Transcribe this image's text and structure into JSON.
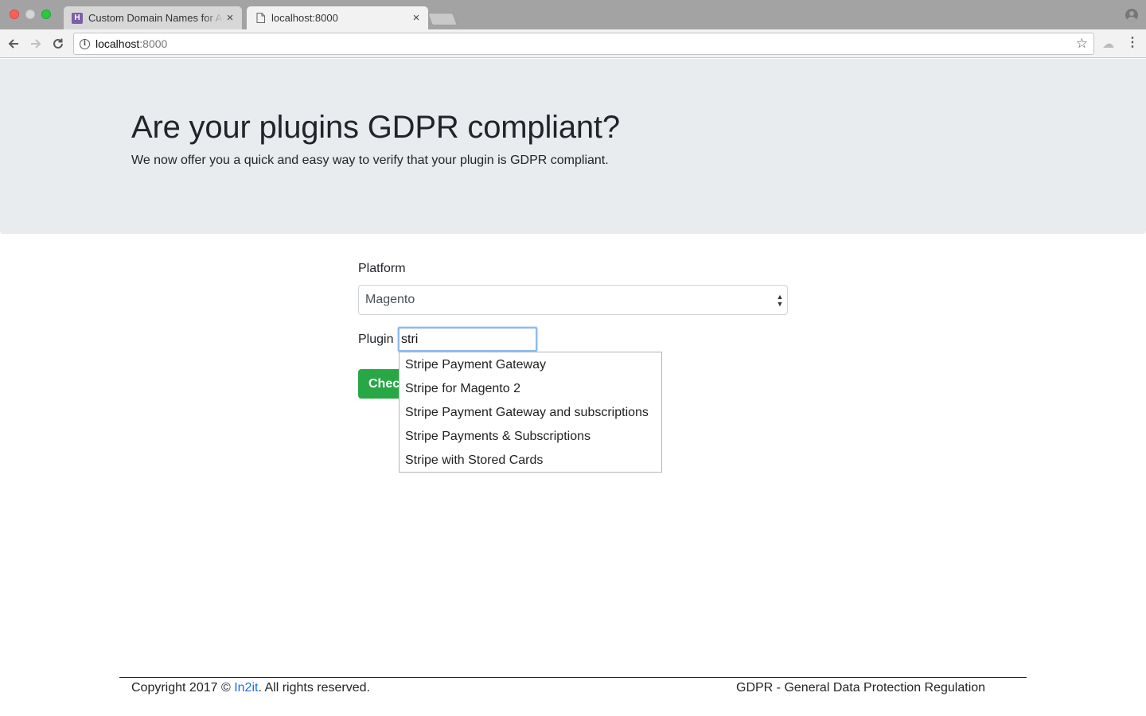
{
  "browser": {
    "tabs": [
      {
        "title": "Custom Domain Names for Ap",
        "favicon": "H",
        "active": false
      },
      {
        "title": "localhost:8000",
        "active": true
      }
    ],
    "url_host": "localhost",
    "url_port": ":8000"
  },
  "hero": {
    "title": "Are your plugins GDPR compliant?",
    "subtitle": "We now offer you a quick and easy way to verify that your plugin is GDPR compliant."
  },
  "form": {
    "platform_label": "Platform",
    "platform_value": "Magento",
    "plugin_label": "Plugin",
    "plugin_value": "stri",
    "submit_label": "Check"
  },
  "autocomplete": {
    "items": [
      "Stripe Payment Gateway",
      "Stripe for Magento 2",
      "Stripe Payment Gateway and subscriptions",
      "Stripe Payments & Subscriptions",
      "Stripe with Stored Cards"
    ]
  },
  "footer": {
    "copyright_prefix": "Copyright 2017 © ",
    "company_link": "In2it",
    "copyright_suffix": ". All rights reserved.",
    "right_text": "GDPR - General Data Protection Regulation"
  },
  "colors": {
    "jumbotron_bg": "#e9ecef",
    "button_green": "#28a745",
    "link_blue": "#1a6fe0"
  }
}
